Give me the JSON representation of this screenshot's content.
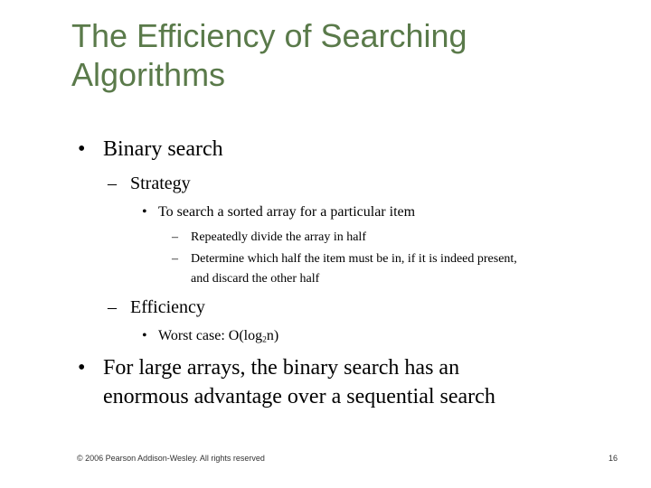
{
  "slide": {
    "title_line1": "The Efficiency of Searching",
    "title_line2": "Algorithms",
    "title_color": "#5a7a4a",
    "bullets": {
      "b1": "Binary search",
      "b1_strategy": "Strategy",
      "b1_strategy_point": "To search a sorted array for a particular item",
      "b1_strategy_sub1": "Repeatedly divide the array in half",
      "b1_strategy_sub2_line1": "Determine which half the item must be in, if it is indeed present,",
      "b1_strategy_sub2_line2": "and discard the other half",
      "b1_efficiency": "Efficiency",
      "b1_efficiency_point_prefix": "Worst case: O(log",
      "b1_efficiency_point_sub": "2",
      "b1_efficiency_point_suffix": "n)",
      "b2_line1": "For large arrays, the binary search has an",
      "b2_line2": "enormous advantage over a sequential search"
    },
    "bullet_glyph": "•",
    "dash_glyph": "–",
    "footer": {
      "copyright": "© 2006 Pearson Addison-Wesley. All rights reserved",
      "page_number": "16"
    }
  }
}
